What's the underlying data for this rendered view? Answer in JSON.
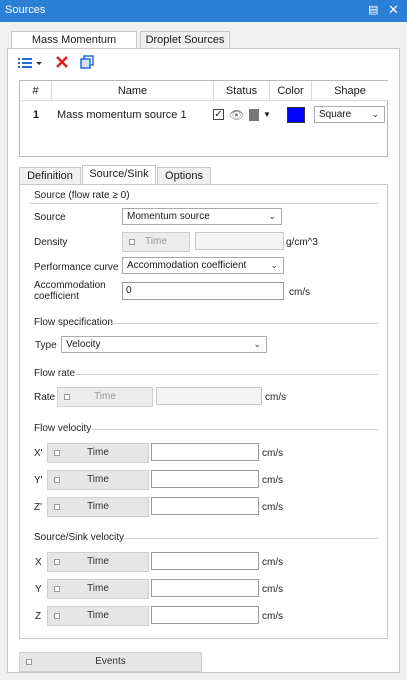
{
  "window": {
    "title": "Sources",
    "pin_icon": "pin-icon",
    "close_icon": "close-icon"
  },
  "top_tabs": [
    {
      "label": "Mass Momentum Sources",
      "active": true
    },
    {
      "label": "Droplet Sources",
      "active": false
    }
  ],
  "toolbar": {
    "add_icon": "add-list-icon",
    "delete_icon": "delete-icon",
    "copy_icon": "copy-icon"
  },
  "grid": {
    "columns": [
      "#",
      "Name",
      "Status",
      "Color",
      "Shape"
    ],
    "rows": [
      {
        "index": "1",
        "name": "Mass momentum source 1",
        "checked": true,
        "color": "#0000ff",
        "shape": "Square"
      }
    ]
  },
  "sub_tabs": [
    {
      "label": "Definition",
      "active": false
    },
    {
      "label": "Source/Sink",
      "active": true
    },
    {
      "label": "Options",
      "active": false
    }
  ],
  "source_group": {
    "title": "Source (flow rate ≥ 0)",
    "source_label": "Source",
    "source_value": "Momentum source",
    "density_label": "Density",
    "density_time": "Time",
    "density_unit": "g/cm^3",
    "perf_label": "Performance curve",
    "perf_value": "Accommodation coefficient",
    "accom_label_1": "Accommodation",
    "accom_label_2": "coefficient",
    "accom_value": "0",
    "accom_unit": "cm/s"
  },
  "flow_spec": {
    "title": "Flow specification",
    "type_label": "Type",
    "type_value": "Velocity"
  },
  "flow_rate": {
    "title": "Flow rate",
    "rate_label": "Rate",
    "time": "Time",
    "unit": "cm/s"
  },
  "flow_velocity": {
    "title": "Flow velocity",
    "rows": [
      {
        "axis": "X'",
        "time": "Time",
        "unit": "cm/s"
      },
      {
        "axis": "Y'",
        "time": "Time",
        "unit": "cm/s"
      },
      {
        "axis": "Z'",
        "time": "Time",
        "unit": "cm/s"
      }
    ]
  },
  "sink_velocity": {
    "title": "Source/Sink velocity",
    "rows": [
      {
        "axis": "X",
        "time": "Time",
        "unit": "cm/s"
      },
      {
        "axis": "Y",
        "time": "Time",
        "unit": "cm/s"
      },
      {
        "axis": "Z",
        "time": "Time",
        "unit": "cm/s"
      }
    ]
  },
  "events": {
    "label": "Events"
  }
}
